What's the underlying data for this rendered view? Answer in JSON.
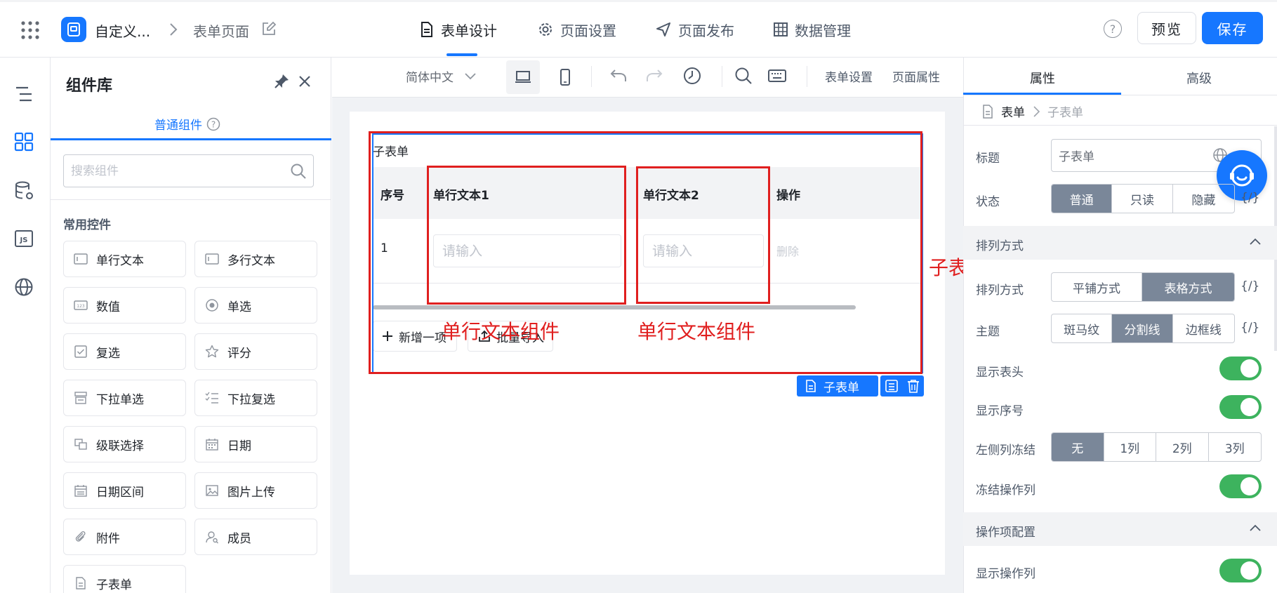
{
  "header": {
    "app_name": "自定义...",
    "page_name": "表单页面",
    "tabs": [
      {
        "label": "表单设计",
        "icon": "document-icon"
      },
      {
        "label": "页面设置",
        "icon": "gear-icon"
      },
      {
        "label": "页面发布",
        "icon": "send-icon"
      },
      {
        "label": "数据管理",
        "icon": "grid-icon"
      }
    ],
    "preview_label": "预览",
    "save_label": "保存",
    "help_symbol": "?"
  },
  "library": {
    "title": "组件库",
    "tab_label": "普通组件",
    "search_placeholder": "搜索组件",
    "section_title": "常用控件",
    "items": [
      {
        "label": "单行文本",
        "icon": "single-line-text-icon"
      },
      {
        "label": "多行文本",
        "icon": "multi-line-text-icon"
      },
      {
        "label": "数值",
        "icon": "number-icon"
      },
      {
        "label": "单选",
        "icon": "radio-icon"
      },
      {
        "label": "复选",
        "icon": "checkbox-icon"
      },
      {
        "label": "评分",
        "icon": "star-icon"
      },
      {
        "label": "下拉单选",
        "icon": "dropdown-single-icon"
      },
      {
        "label": "下拉复选",
        "icon": "dropdown-multi-icon"
      },
      {
        "label": "级联选择",
        "icon": "cascade-icon"
      },
      {
        "label": "日期",
        "icon": "calendar-icon"
      },
      {
        "label": "日期区间",
        "icon": "date-range-icon"
      },
      {
        "label": "图片上传",
        "icon": "image-upload-icon"
      },
      {
        "label": "附件",
        "icon": "paperclip-icon"
      },
      {
        "label": "成员",
        "icon": "member-icon"
      },
      {
        "label": "子表单",
        "icon": "subform-icon"
      }
    ]
  },
  "toolbar": {
    "language": "简体中文",
    "form_settings": "表单设置",
    "page_properties": "页面属性"
  },
  "canvas": {
    "subform_title": "子表单",
    "columns": [
      "序号",
      "单行文本1",
      "单行文本2",
      "操作"
    ],
    "rows": [
      {
        "index": "1",
        "placeholder1": "请输入",
        "placeholder2": "请输入",
        "action": "删除"
      }
    ],
    "add_item": "新增一项",
    "bulk_import": "批量导入",
    "selected_tag": "子表单"
  },
  "annotations": {
    "text_component_1": "单行文本组件",
    "text_component_2": "单行文本组件",
    "subform_component": "子表单组件"
  },
  "properties": {
    "tabs": [
      "属性",
      "高级"
    ],
    "breadcrumb": {
      "root": "表单",
      "current": "子表单"
    },
    "title_label": "标题",
    "title_value": "子表单",
    "status_label": "状态",
    "status_options": [
      "普通",
      "只读",
      "隐藏"
    ],
    "status_selected": "普通",
    "fx_symbol": "{/}",
    "arrange_group": "排列方式",
    "arrange_label": "排列方式",
    "arrange_options": [
      "平铺方式",
      "表格方式"
    ],
    "arrange_selected": "表格方式",
    "theme_label": "主题",
    "theme_options": [
      "斑马纹",
      "分割线",
      "边框线"
    ],
    "theme_selected": "分割线",
    "show_header_label": "显示表头",
    "show_header": true,
    "show_index_label": "显示序号",
    "show_index": true,
    "freeze_left_label": "左侧列冻结",
    "freeze_options": [
      "无",
      "1列",
      "2列",
      "3列"
    ],
    "freeze_selected": "无",
    "freeze_action_label": "冻结操作列",
    "freeze_action": true,
    "action_group": "操作项配置",
    "show_action_label": "显示操作列",
    "show_action": true
  },
  "colors": {
    "primary": "#1677ff",
    "toggle_on": "#3db35e",
    "segment_selected": "#7a8799",
    "annotation_red": "#e01f1f"
  }
}
